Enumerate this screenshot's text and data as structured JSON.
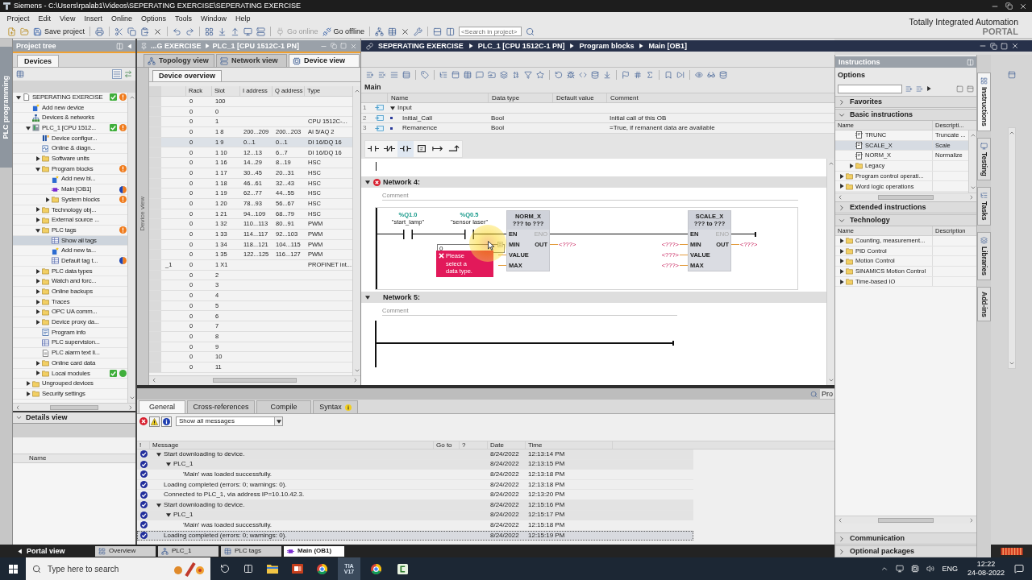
{
  "window": {
    "title": "Siemens - C:\\Users\\rpalab1\\Videos\\SEPERATING EXERCISE\\SEPERATING EXERCISE",
    "brand": "Totally Integrated Automation",
    "brand_sub": "PORTAL"
  },
  "menu": [
    "Project",
    "Edit",
    "View",
    "Insert",
    "Online",
    "Options",
    "Tools",
    "Window",
    "Help"
  ],
  "toolbar": {
    "buttons": [
      {
        "label": "Save project",
        "disabled": false
      },
      {
        "label": "Go online",
        "disabled": true
      },
      {
        "label": "Go offline",
        "disabled": false
      }
    ],
    "search": {
      "placeholder": "<Search in project>"
    }
  },
  "side_tab": {
    "label": "PLC programming"
  },
  "project_tree": {
    "title": "Project tree",
    "tabs": [
      {
        "label": "Devices",
        "selected": true
      }
    ],
    "items": [
      {
        "label": "SEPERATING EXERCISE",
        "kind": "project",
        "expanded": true,
        "selected": false,
        "badges": [
          {
            "kind": "check"
          },
          {
            "kind": "warning"
          }
        ],
        "children": [
          {
            "label": "Add new device",
            "kind": "add",
            "selected": false
          },
          {
            "label": "Devices & networks",
            "kind": "network",
            "selected": false
          },
          {
            "label": "PLC_1 [CPU 1512...",
            "kind": "plc",
            "expanded": true,
            "selected": false,
            "badges": [
              {
                "kind": "check"
              },
              {
                "kind": "warning"
              }
            ],
            "children": [
              {
                "label": "Device configur...",
                "kind": "device",
                "selected": false
              },
              {
                "label": "Online & diagn...",
                "kind": "diagnostics",
                "selected": false
              },
              {
                "label": "Software units",
                "kind": "folder",
                "expanded": false,
                "selected": false
              },
              {
                "label": "Program blocks",
                "kind": "folder",
                "expanded": true,
                "selected": false,
                "badges": [
                  {
                    "kind": "warning"
                  }
                ],
                "children": [
                  {
                    "label": "Add new bl...",
                    "kind": "add",
                    "selected": false
                  },
                  {
                    "label": "Main [OB1]",
                    "kind": "block",
                    "selected": false,
                    "badges": [
                      {
                        "kind": "split"
                      }
                    ]
                  },
                  {
                    "label": "System blocks",
                    "kind": "folder",
                    "expanded": false,
                    "selected": false,
                    "badges": [
                      {
                        "kind": "warning"
                      }
                    ]
                  }
                ]
              },
              {
                "label": "Technology obj...",
                "kind": "folder",
                "expanded": false,
                "selected": false
              },
              {
                "label": "External source ...",
                "kind": "folder",
                "expanded": false,
                "selected": false
              },
              {
                "label": "PLC tags",
                "kind": "folder",
                "expanded": true,
                "selected": false,
                "badges": [
                  {
                    "kind": "warning"
                  }
                ],
                "children": [
                  {
                    "label": "Show all tags",
                    "kind": "tags",
                    "selected": true
                  },
                  {
                    "label": "Add new ta...",
                    "kind": "add",
                    "selected": false
                  },
                  {
                    "label": "Default tag t...",
                    "kind": "tags",
                    "selected": false,
                    "badges": [
                      {
                        "kind": "split"
                      }
                    ]
                  }
                ]
              },
              {
                "label": "PLC data types",
                "kind": "folder",
                "expanded": false,
                "selected": false
              },
              {
                "label": "Watch and forc...",
                "kind": "folder",
                "expanded": false,
                "selected": false
              },
              {
                "label": "Online backups",
                "kind": "folder",
                "expanded": false,
                "selected": false
              },
              {
                "label": "Traces",
                "kind": "folder",
                "expanded": false,
                "selected": false
              },
              {
                "label": "OPC UA comm...",
                "kind": "folder",
                "expanded": false,
                "selected": false
              },
              {
                "label": "Device proxy da...",
                "kind": "folder",
                "expanded": false,
                "selected": false
              },
              {
                "label": "Program info",
                "kind": "info",
                "selected": false
              },
              {
                "label": "PLC supervision...",
                "kind": "tags",
                "selected": false
              },
              {
                "label": "PLC alarm text li...",
                "kind": "document",
                "selected": false
              },
              {
                "label": "Online card data",
                "kind": "folder",
                "expanded": false,
                "selected": false
              },
              {
                "label": "Local modules",
                "kind": "folder",
                "expanded": false,
                "selected": false,
                "badges": [
                  {
                    "kind": "check"
                  },
                  {
                    "kind": "online"
                  }
                ]
              }
            ]
          },
          {
            "label": "Ungrouped devices",
            "kind": "folder",
            "expanded": false,
            "selected": false
          },
          {
            "label": "Security settings",
            "kind": "folder",
            "expanded": false,
            "selected": false
          }
        ]
      }
    ]
  },
  "details_view": {
    "title": "Details view",
    "columns": [
      "Name"
    ]
  },
  "device_window": {
    "breadcrumb": [
      "...G EXERCISE",
      "PLC_1 [CPU 1512C-1 PN]"
    ],
    "tabs": [
      {
        "label": "Topology view",
        "selected": false
      },
      {
        "label": "Network view",
        "selected": false
      },
      {
        "label": "Device view",
        "selected": true
      }
    ],
    "side_label": "Device view",
    "overview": {
      "tabs": [
        {
          "label": "Device overview",
          "selected": true
        }
      ],
      "columns": [
        "Rack",
        "Slot",
        "I address",
        "Q address",
        "Type"
      ],
      "rows": [
        {
          "rack": "0",
          "slot": "100",
          "selected": false
        },
        {
          "rack": "0",
          "slot": "0",
          "selected": false
        },
        {
          "rack": "0",
          "slot": "1",
          "type": "CPU 1512C-...",
          "selected": false
        },
        {
          "rack": "0",
          "slot": "1 8",
          "i_address": "200...209",
          "q_address": "200...203",
          "type": "AI 5/AQ 2",
          "selected": false
        },
        {
          "rack": "0",
          "slot": "1 9",
          "i_address": "0...1",
          "q_address": "0...1",
          "type": "DI 16/DQ 16",
          "selected": true
        },
        {
          "rack": "0",
          "slot": "1 10",
          "i_address": "12...13",
          "q_address": "6...7",
          "type": "DI 16/DQ 16",
          "selected": false
        },
        {
          "rack": "0",
          "slot": "1 16",
          "i_address": "14...29",
          "q_address": "8...19",
          "type": "HSC",
          "selected": false
        },
        {
          "rack": "0",
          "slot": "1 17",
          "i_address": "30...45",
          "q_address": "20...31",
          "type": "HSC",
          "selected": false
        },
        {
          "rack": "0",
          "slot": "1 18",
          "i_address": "46...61",
          "q_address": "32...43",
          "type": "HSC",
          "selected": false
        },
        {
          "rack": "0",
          "slot": "1 19",
          "i_address": "62...77",
          "q_address": "44...55",
          "type": "HSC",
          "selected": false
        },
        {
          "rack": "0",
          "slot": "1 20",
          "i_address": "78...93",
          "q_address": "56...67",
          "type": "HSC",
          "selected": false
        },
        {
          "rack": "0",
          "slot": "1 21",
          "i_address": "94...109",
          "q_address": "68...79",
          "type": "HSC",
          "selected": false
        },
        {
          "rack": "0",
          "slot": "1 32",
          "i_address": "110...113",
          "q_address": "80...91",
          "type": "PWM",
          "selected": false
        },
        {
          "rack": "0",
          "slot": "1 33",
          "i_address": "114...117",
          "q_address": "92...103",
          "type": "PWM",
          "selected": false
        },
        {
          "rack": "0",
          "slot": "1 34",
          "i_address": "118...121",
          "q_address": "104...115",
          "type": "PWM",
          "selected": false
        },
        {
          "rack": "0",
          "slot": "1 35",
          "i_address": "122...125",
          "q_address": "116...127",
          "type": "PWM",
          "selected": false
        },
        {
          "module": "_1",
          "rack": "0",
          "slot": "1 X1",
          "type": "PROFINET int...",
          "selected": false
        },
        {
          "rack": "0",
          "slot": "2",
          "selected": false
        },
        {
          "rack": "0",
          "slot": "3",
          "selected": false
        },
        {
          "rack": "0",
          "slot": "4",
          "selected": false
        },
        {
          "rack": "0",
          "slot": "5",
          "selected": false
        },
        {
          "rack": "0",
          "slot": "6",
          "selected": false
        },
        {
          "rack": "0",
          "slot": "7",
          "selected": false
        },
        {
          "rack": "0",
          "slot": "8",
          "selected": false
        },
        {
          "rack": "0",
          "slot": "9",
          "selected": false
        },
        {
          "rack": "0",
          "slot": "10",
          "selected": false
        },
        {
          "rack": "0",
          "slot": "11",
          "selected": false
        }
      ]
    }
  },
  "editor": {
    "breadcrumb": [
      "SEPERATING EXERCISE",
      "PLC_1 [CPU 1512C-1 PN]",
      "Program blocks",
      "Main [OB1]"
    ],
    "interface": {
      "title": "Main",
      "columns": [
        "Name",
        "Data type",
        "Default value",
        "Comment"
      ],
      "rows": [
        {
          "number": "1",
          "kind": "section",
          "name": "Input",
          "expanded": true
        },
        {
          "number": "2",
          "kind": "variable",
          "name": "Initial_Call",
          "data_type": "Bool",
          "comment": "Initial call of this OB"
        },
        {
          "number": "3",
          "kind": "variable",
          "name": "Remanence",
          "data_type": "Bool",
          "comment": "=True, if remanent data are available"
        }
      ]
    },
    "networks": [
      {
        "title": "Network 4:",
        "expanded": true,
        "error": true,
        "comment": {
          "placeholder": "Comment"
        },
        "contacts": [
          {
            "address": "%Q1.0",
            "tag": "\"start_lamp\""
          },
          {
            "address": "%Q0.5",
            "tag": "\"sensor laser\""
          }
        ],
        "boxes": [
          {
            "name": "NORM_X",
            "types": "??? to ???",
            "enable": "EN",
            "enable_out": "ENO",
            "inputs": [
              {
                "pin": "MIN"
              },
              {
                "pin": "VALUE"
              },
              {
                "pin": "MAX"
              }
            ],
            "output": {
              "pin": "OUT",
              "operand": "<???>"
            }
          },
          {
            "name": "SCALE_X",
            "types": "??? to ???",
            "enable": "EN",
            "enable_out": "ENO",
            "inputs": [
              {
                "pin": "MIN",
                "operand": "<???>"
              },
              {
                "pin": "VALUE",
                "operand": "<???>"
              },
              {
                "pin": "MAX",
                "operand": "<???>"
              }
            ],
            "output": {
              "pin": "OUT",
              "operand": "<???>"
            }
          }
        ],
        "edit_field": {
          "value": "0"
        },
        "error_tip": "Please select a data type."
      },
      {
        "title": "Network 5:",
        "expanded": true,
        "error": false,
        "comment": {
          "placeholder": "Comment"
        }
      }
    ]
  },
  "inspector": {
    "properties_tab": "Pro",
    "tabs": [
      {
        "label": "General",
        "selected": true,
        "info": false
      },
      {
        "label": "Cross-references",
        "selected": false,
        "info": false
      },
      {
        "label": "Compile",
        "selected": false,
        "info": false
      },
      {
        "label": "Syntax",
        "selected": false,
        "info": true
      }
    ],
    "filter": {
      "value": "Show all messages"
    },
    "columns": [
      "!",
      "Message",
      "Go to",
      "?",
      "Date",
      "Time"
    ],
    "messages": [
      {
        "kind": "success",
        "text": "Start downloading to device.",
        "date": "8/24/2022",
        "time": "12:13:14 PM",
        "expanded": true,
        "selected": false,
        "children": [
          {
            "kind": "success",
            "text": "PLC_1",
            "date": "8/24/2022",
            "time": "12:13:15 PM",
            "expanded": true,
            "selected": false,
            "children": [
              {
                "kind": "success",
                "text": "'Main' was loaded successfully.",
                "date": "8/24/2022",
                "time": "12:13:18 PM",
                "selected": false
              }
            ]
          }
        ]
      },
      {
        "kind": "success",
        "text": "Loading completed (errors: 0; warnings: 0).",
        "date": "8/24/2022",
        "time": "12:13:18 PM",
        "selected": false
      },
      {
        "kind": "success",
        "text": "Connected to PLC_1, via address IP=10.10.42.3.",
        "date": "8/24/2022",
        "time": "12:13:20 PM",
        "selected": false
      },
      {
        "kind": "success",
        "text": "Start downloading to device.",
        "date": "8/24/2022",
        "time": "12:15:16 PM",
        "expanded": true,
        "selected": false,
        "children": [
          {
            "kind": "success",
            "text": "PLC_1",
            "date": "8/24/2022",
            "time": "12:15:17 PM",
            "expanded": true,
            "selected": false,
            "children": [
              {
                "kind": "success",
                "text": "'Main' was loaded successfully.",
                "date": "8/24/2022",
                "time": "12:15:18 PM",
                "selected": false
              }
            ]
          }
        ]
      },
      {
        "kind": "success",
        "text": "Loading completed (errors: 0; warnings: 0).",
        "date": "8/24/2022",
        "time": "12:15:19 PM",
        "selected": true
      }
    ]
  },
  "instructions": {
    "title": "Instructions",
    "options": "Options",
    "sections": [
      {
        "title": "Favorites",
        "expanded": false
      },
      {
        "title": "Basic instructions",
        "expanded": true,
        "columns": [
          "Name",
          "Descripti..."
        ],
        "items": [
          {
            "children": [
              {
                "kind": "instruction",
                "name": "TRUNC",
                "description": "Truncate ...",
                "selected": false
              },
              {
                "kind": "instruction",
                "name": "SCALE_X",
                "description": "Scale",
                "selected": true
              },
              {
                "kind": "instruction",
                "name": "NORM_X",
                "description": "Normalize",
                "selected": false
              },
              {
                "kind": "folder",
                "name": "Legacy",
                "expanded": false,
                "selected": false
              }
            ]
          },
          {
            "kind": "folder",
            "name": "Program control operati...",
            "expanded": false,
            "selected": false
          },
          {
            "kind": "folder",
            "name": "Word logic operations",
            "expanded": false,
            "selected": false
          }
        ]
      },
      {
        "title": "Extended instructions",
        "expanded": false
      },
      {
        "title": "Technology",
        "expanded": true,
        "columns": [
          "Name",
          "Description"
        ],
        "items": [
          {
            "kind": "folder",
            "name": "Counting, measurement...",
            "expanded": false,
            "selected": false
          },
          {
            "kind": "folder",
            "name": "PID Control",
            "expanded": false,
            "selected": false
          },
          {
            "kind": "folder",
            "name": "Motion Control",
            "expanded": false,
            "selected": false
          },
          {
            "kind": "folder",
            "name": "SINAMICS Motion Control",
            "expanded": false,
            "selected": false
          },
          {
            "kind": "folder",
            "name": "Time-based IO",
            "expanded": false,
            "selected": false
          }
        ]
      },
      {
        "title": "Communication",
        "expanded": false
      },
      {
        "title": "Optional packages",
        "expanded": false
      }
    ],
    "side_tabs": [
      {
        "label": "Instructions",
        "selected": true
      },
      {
        "label": "Testing",
        "selected": false
      },
      {
        "label": "Tasks",
        "selected": false
      },
      {
        "label": "Libraries",
        "selected": false
      },
      {
        "label": "Add-ins",
        "selected": false
      }
    ]
  },
  "portal_bar": {
    "portal_view": "Portal view",
    "tabs": [
      {
        "label": "Overview",
        "selected": false
      },
      {
        "label": "PLC_1",
        "selected": false
      },
      {
        "label": "PLC tags",
        "selected": false
      },
      {
        "label": "Main (OB1)",
        "selected": true
      }
    ]
  },
  "taskbar": {
    "search": {
      "placeholder": "Type here to search"
    },
    "app_label": "TIA V17",
    "language": "ENG",
    "time": "12:22",
    "date": "24-08-2022"
  }
}
